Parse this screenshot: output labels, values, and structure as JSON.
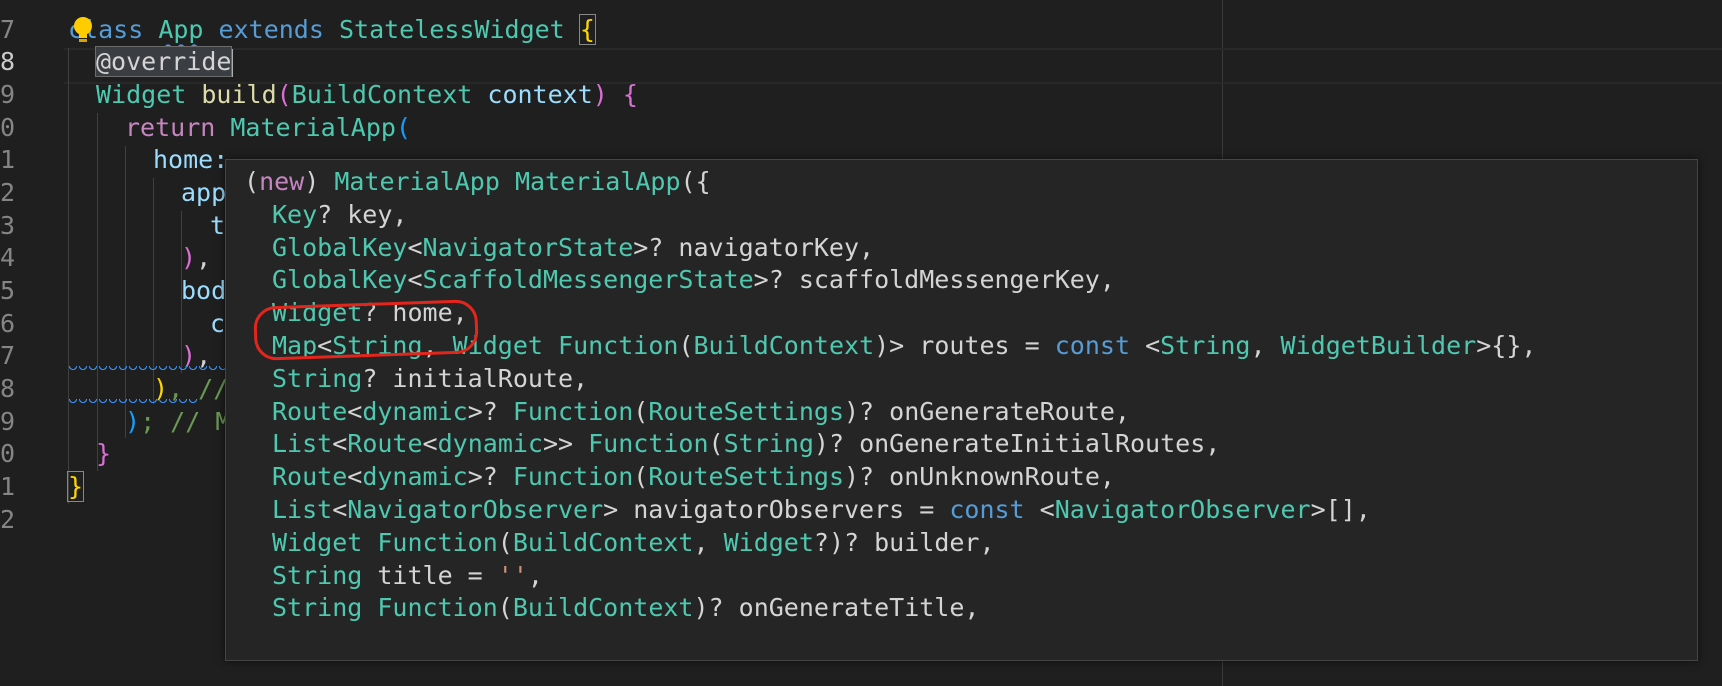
{
  "gutter": {
    "line_numbers": [
      "7",
      "8",
      "9",
      "0",
      "1",
      "2",
      "3",
      "4",
      "5",
      "6",
      "7",
      "8",
      "9",
      "0",
      "1",
      "2"
    ],
    "active_index": 1
  },
  "code": {
    "l7": {
      "kw_class": "class",
      "name": "App",
      "kw_extends": "extends",
      "base": "StatelessWidget",
      "open": "{"
    },
    "l8": {
      "annotation": "@override"
    },
    "l9": {
      "type": "Widget",
      "fn": "build",
      "open_paren": "(",
      "param_type": "BuildContext",
      "param": "context",
      "close_paren": ")",
      "open": "{"
    },
    "l10": {
      "kw": "return",
      "ctor": "MaterialApp",
      "paren": "("
    },
    "l11": {
      "prop": "home:"
    },
    "l12": {
      "prop": "app"
    },
    "l13": {
      "prop": "t"
    },
    "l14": {
      "close": ")",
      "comma": ","
    },
    "l15": {
      "prop": "bod"
    },
    "l16": {
      "prop": "c"
    },
    "l17": {
      "close": ")",
      "comma": ","
    },
    "l18": {
      "close": ")",
      "rest": ", //"
    },
    "l19": {
      "close": ")",
      "rest": "; // M"
    },
    "l20": {
      "close": "}"
    },
    "l21": {
      "close": "}"
    }
  },
  "popup": {
    "lines": [
      {
        "segments": [
          [
            "p",
            "("
          ],
          [
            "kc",
            "new"
          ],
          [
            "p",
            ") "
          ],
          [
            "t",
            "MaterialApp"
          ],
          [
            "p",
            " "
          ],
          [
            "t",
            "MaterialApp"
          ],
          [
            "p",
            "({"
          ]
        ]
      },
      {
        "segments": [
          [
            "t",
            "Key"
          ],
          [
            "p",
            "? key,"
          ]
        ]
      },
      {
        "segments": [
          [
            "t",
            "GlobalKey"
          ],
          [
            "p",
            "<"
          ],
          [
            "t",
            "NavigatorState"
          ],
          [
            "p",
            ">? navigatorKey,"
          ]
        ]
      },
      {
        "segments": [
          [
            "t",
            "GlobalKey"
          ],
          [
            "p",
            "<"
          ],
          [
            "t",
            "ScaffoldMessengerState"
          ],
          [
            "p",
            ">? scaffoldMessengerKey,"
          ]
        ]
      },
      {
        "segments": [
          [
            "t",
            "Widget"
          ],
          [
            "p",
            "? home,"
          ]
        ]
      },
      {
        "segments": [
          [
            "t",
            "Map"
          ],
          [
            "p",
            "<"
          ],
          [
            "t",
            "String"
          ],
          [
            "p",
            ", "
          ],
          [
            "t",
            "Widget"
          ],
          [
            "p",
            " "
          ],
          [
            "t",
            "Function"
          ],
          [
            "p",
            "("
          ],
          [
            "t",
            "BuildContext"
          ],
          [
            "p",
            ")> routes = "
          ],
          [
            "k",
            "const"
          ],
          [
            "p",
            " <"
          ],
          [
            "t",
            "String"
          ],
          [
            "p",
            ", "
          ],
          [
            "t",
            "WidgetBuilder"
          ],
          [
            "p",
            ">{},"
          ]
        ]
      },
      {
        "segments": [
          [
            "t",
            "String"
          ],
          [
            "p",
            "? initialRoute,"
          ]
        ]
      },
      {
        "segments": [
          [
            "t",
            "Route"
          ],
          [
            "p",
            "<"
          ],
          [
            "t",
            "dynamic"
          ],
          [
            "p",
            ">? "
          ],
          [
            "t",
            "Function"
          ],
          [
            "p",
            "("
          ],
          [
            "t",
            "RouteSettings"
          ],
          [
            "p",
            ")? onGenerateRoute,"
          ]
        ]
      },
      {
        "segments": [
          [
            "t",
            "List"
          ],
          [
            "p",
            "<"
          ],
          [
            "t",
            "Route"
          ],
          [
            "p",
            "<"
          ],
          [
            "t",
            "dynamic"
          ],
          [
            "p",
            ">> "
          ],
          [
            "t",
            "Function"
          ],
          [
            "p",
            "("
          ],
          [
            "t",
            "String"
          ],
          [
            "p",
            ")? onGenerateInitialRoutes,"
          ]
        ]
      },
      {
        "segments": [
          [
            "t",
            "Route"
          ],
          [
            "p",
            "<"
          ],
          [
            "t",
            "dynamic"
          ],
          [
            "p",
            ">? "
          ],
          [
            "t",
            "Function"
          ],
          [
            "p",
            "("
          ],
          [
            "t",
            "RouteSettings"
          ],
          [
            "p",
            ")? onUnknownRoute,"
          ]
        ]
      },
      {
        "segments": [
          [
            "t",
            "List"
          ],
          [
            "p",
            "<"
          ],
          [
            "t",
            "NavigatorObserver"
          ],
          [
            "p",
            "> navigatorObservers = "
          ],
          [
            "k",
            "const"
          ],
          [
            "p",
            " <"
          ],
          [
            "t",
            "NavigatorObserver"
          ],
          [
            "p",
            ">[],"
          ]
        ]
      },
      {
        "segments": [
          [
            "t",
            "Widget"
          ],
          [
            "p",
            " "
          ],
          [
            "t",
            "Function"
          ],
          [
            "p",
            "("
          ],
          [
            "t",
            "BuildContext"
          ],
          [
            "p",
            ", "
          ],
          [
            "t",
            "Widget"
          ],
          [
            "p",
            "?)? builder,"
          ]
        ]
      },
      {
        "segments": [
          [
            "t",
            "String"
          ],
          [
            "p",
            " title = "
          ],
          [
            "s",
            "''"
          ],
          [
            "p",
            ","
          ]
        ]
      },
      {
        "segments": [
          [
            "t",
            "String"
          ],
          [
            "p",
            " "
          ],
          [
            "t",
            "Function"
          ],
          [
            "p",
            "("
          ],
          [
            "t",
            "BuildContext"
          ],
          [
            "p",
            ")? onGenerateTitle,"
          ]
        ]
      }
    ]
  },
  "colors": {
    "background": "#1f1f1f",
    "popup_background": "#252526",
    "annotation_circle": "#e3261c",
    "type": "#4ec9b0",
    "keyword": "#569cd6",
    "control_keyword": "#c586c0"
  },
  "icons": [
    "lightbulb-icon"
  ]
}
